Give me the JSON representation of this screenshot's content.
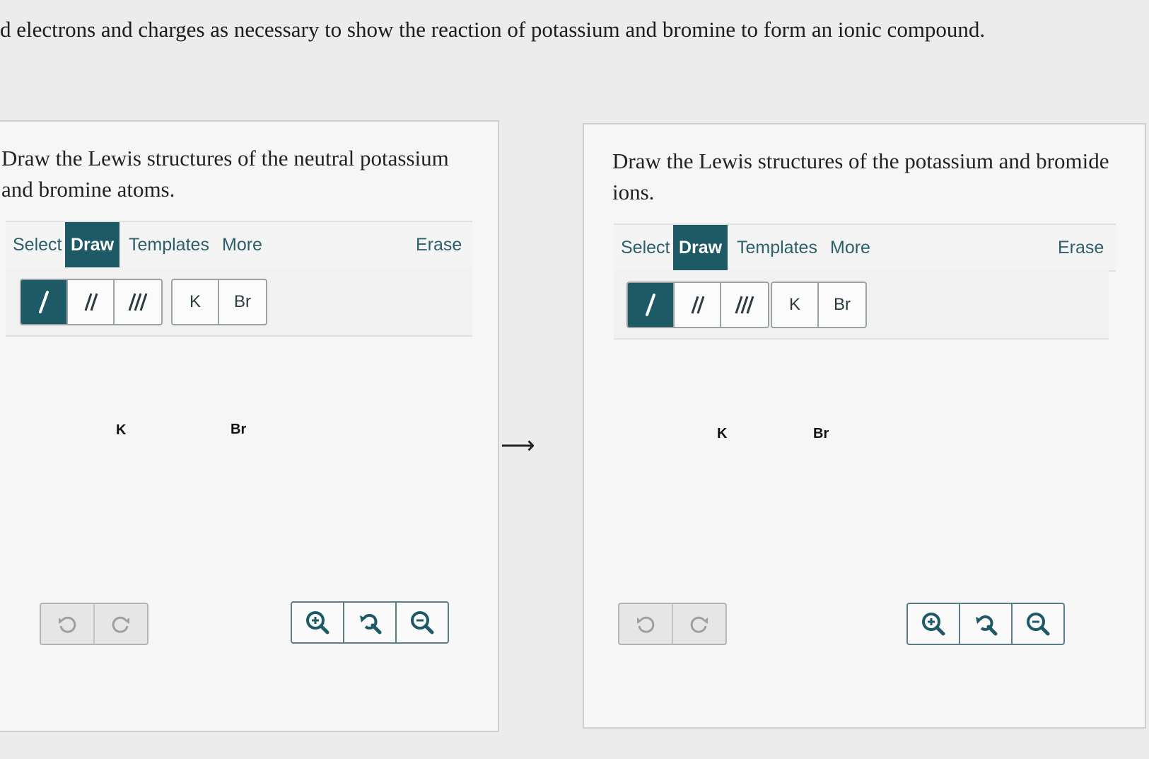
{
  "instruction": "d electrons and charges as necessary to show the reaction of potassium and bromine to form an ionic compound.",
  "arrow": "⟶",
  "panels": [
    {
      "prompt": "Draw the Lewis structures of the neutral potassium and bromine atoms.",
      "tabs": {
        "select": "Select",
        "draw": "Draw",
        "templates": "Templates",
        "more": "More",
        "erase": "Erase"
      },
      "atoms": {
        "k": "K",
        "br": "Br"
      },
      "canvas_atoms": {
        "k": "K",
        "br": "Br"
      }
    },
    {
      "prompt": "Draw the Lewis structures of the potassium and bromide ions.",
      "tabs": {
        "select": "Select",
        "draw": "Draw",
        "templates": "Templates",
        "more": "More",
        "erase": "Erase"
      },
      "atoms": {
        "k": "K",
        "br": "Br"
      },
      "canvas_atoms": {
        "k": "K",
        "br": "Br"
      }
    }
  ],
  "icons": [
    "single-bond-icon",
    "double-bond-icon",
    "triple-bond-icon",
    "undo-icon",
    "redo-icon",
    "zoom-in-icon",
    "zoom-reset-icon",
    "zoom-out-icon"
  ],
  "colors": {
    "accent": "#1d5a66",
    "tab_text": "#2d5f6b"
  }
}
